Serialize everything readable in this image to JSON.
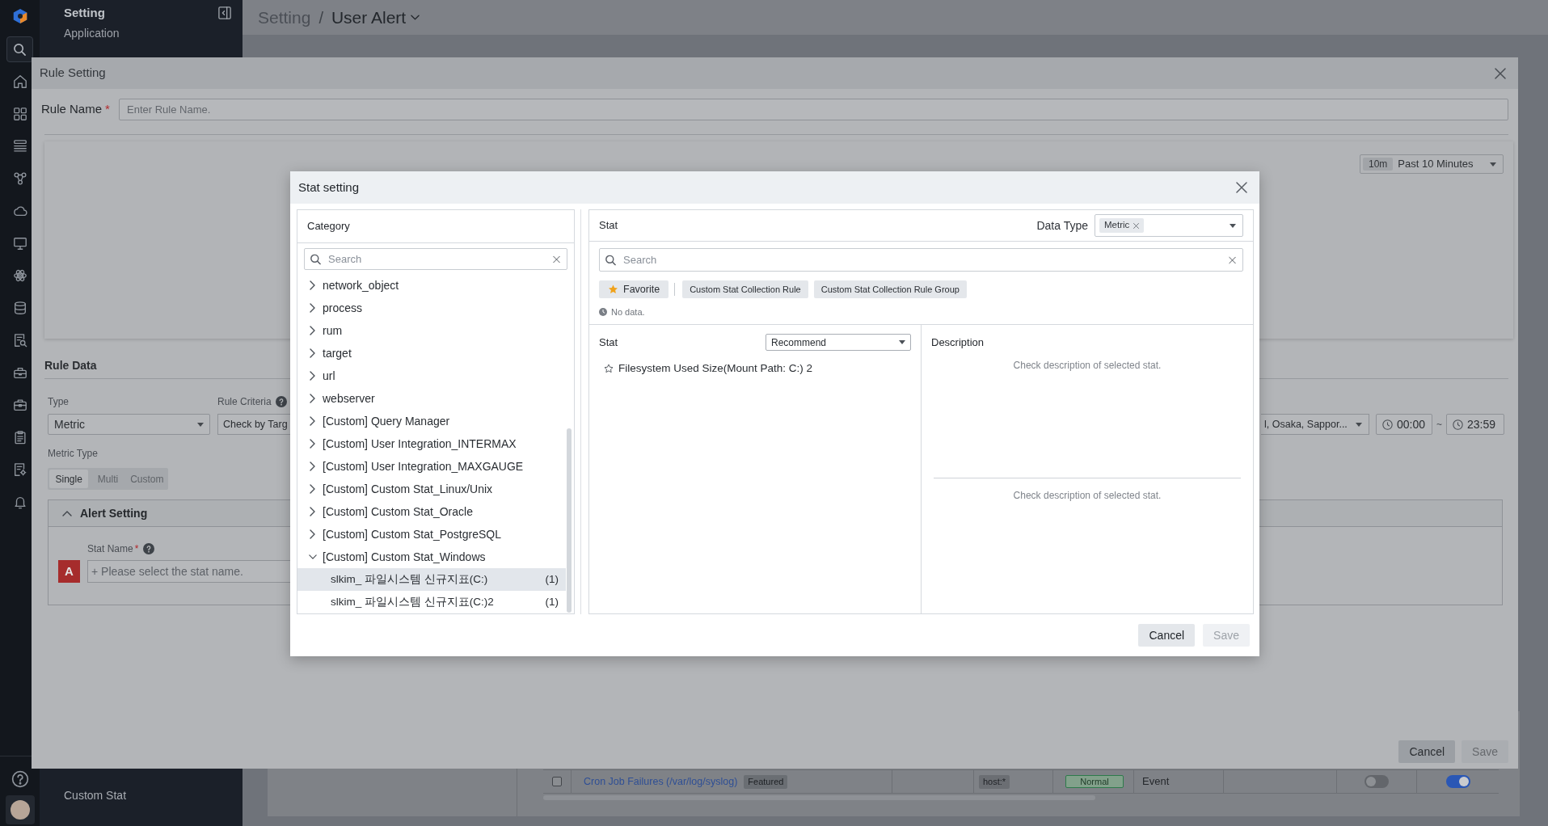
{
  "sidebar": {
    "title": "Setting",
    "top_items": [
      {
        "label": "Application"
      }
    ],
    "bottom_items": [
      {
        "label": "Custom Stat"
      }
    ]
  },
  "breadcrumb": {
    "items": [
      {
        "label": "Setting",
        "dropdown": false
      },
      {
        "label": "User Alert",
        "dropdown": true
      }
    ],
    "separator": "/"
  },
  "background_table": {
    "rows": [
      {
        "cells": [
          {
            "kind": "checkbox",
            "checked": false
          },
          {
            "kind": "link",
            "text": "Cron Job Failures (/var/log/syslog)",
            "tag": "Featured"
          },
          {
            "kind": "blank"
          },
          {
            "kind": "chip",
            "text": "host:*"
          },
          {
            "kind": "status",
            "text": "Normal"
          },
          {
            "kind": "text",
            "text": "Event"
          },
          {
            "kind": "blank"
          },
          {
            "kind": "toggle",
            "on": false
          },
          {
            "kind": "toggle",
            "on": true
          }
        ]
      }
    ]
  },
  "rule_setting": {
    "title": "Rule Setting",
    "rule_name": {
      "label": "Rule Name",
      "required_mark": "*",
      "placeholder": "Enter Rule Name."
    },
    "time_range": {
      "badge": "10m",
      "value": "Past 10 Minutes"
    },
    "rule_data": {
      "title": "Rule Data",
      "type": {
        "label": "Type",
        "value": "Metric"
      },
      "rule_criteria": {
        "label": "Rule Criteria",
        "value": "Check by Targ"
      },
      "region": {
        "value": "l, Osaka, Sappor..."
      },
      "time_from": "00:00",
      "time_separator": "~",
      "time_to": "23:59",
      "metric_type": {
        "label": "Metric Type",
        "options": [
          {
            "label": "Single",
            "selected": true
          },
          {
            "label": "Multi",
            "selected": false
          },
          {
            "label": "Custom",
            "selected": false
          }
        ]
      },
      "alert_setting": {
        "title": "Alert Setting",
        "expanded": true,
        "stat_name": {
          "label": "Stat Name",
          "required_mark": "*",
          "badge": "A",
          "placeholder": "+ Please select the stat name."
        }
      }
    },
    "buttons": [
      {
        "label": "Cancel",
        "disabled": false
      },
      {
        "label": "Save",
        "disabled": true
      }
    ]
  },
  "stat_setting": {
    "title": "Stat setting",
    "category": {
      "title": "Category",
      "search_placeholder": "Search",
      "tree": [
        {
          "label": "network_object",
          "expanded": false
        },
        {
          "label": "process",
          "expanded": false
        },
        {
          "label": "rum",
          "expanded": false
        },
        {
          "label": "target",
          "expanded": false
        },
        {
          "label": "url",
          "expanded": false
        },
        {
          "label": "webserver",
          "expanded": false
        },
        {
          "label": "[Custom] Query Manager",
          "expanded": false
        },
        {
          "label": "[Custom] User Integration_INTERMAX",
          "expanded": false
        },
        {
          "label": "[Custom] User Integration_MAXGAUGE",
          "expanded": false
        },
        {
          "label": "[Custom] Custom Stat_Linux/Unix",
          "expanded": false
        },
        {
          "label": "[Custom] Custom Stat_Oracle",
          "expanded": false
        },
        {
          "label": "[Custom] Custom Stat_PostgreSQL",
          "expanded": false
        },
        {
          "label": "[Custom] Custom Stat_Windows",
          "expanded": true,
          "children": [
            {
              "label": "slkim_ 파일시스템 신규지표(C:)",
              "count": "(1)",
              "selected": true
            },
            {
              "label": "slkim_ 파일시스템 신규지표(C:)2",
              "count": "(1)",
              "selected": false
            }
          ]
        }
      ]
    },
    "stat": {
      "title": "Stat",
      "data_type": {
        "label": "Data Type",
        "tags": [
          "Metric"
        ]
      },
      "search_placeholder": "Search",
      "filters": [
        {
          "kind": "favorite",
          "label": "Favorite"
        },
        {
          "kind": "plain",
          "label": "Custom Stat Collection Rule"
        },
        {
          "kind": "plain",
          "label": "Custom Stat Collection Rule Group"
        }
      ],
      "status": "No data.",
      "list": {
        "title": "Stat",
        "sort": "Recommend",
        "items": [
          {
            "label": "Filesystem Used Size(Mount Path: C:) 2",
            "favorite": false
          }
        ]
      },
      "description": {
        "title": "Description",
        "messages": [
          "Check description of selected stat.",
          "Check description of selected stat."
        ]
      }
    },
    "buttons": [
      {
        "label": "Cancel",
        "disabled": false
      },
      {
        "label": "Save",
        "disabled": true
      }
    ]
  }
}
